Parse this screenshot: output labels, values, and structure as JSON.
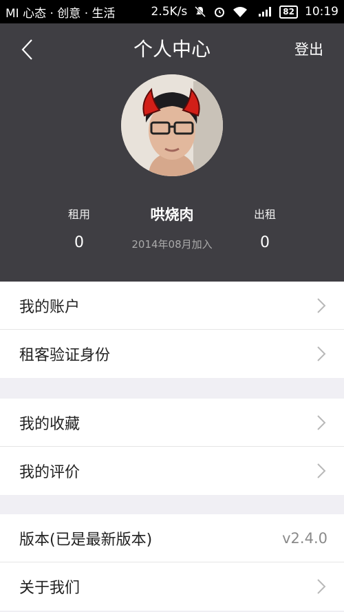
{
  "status_bar": {
    "carrier": "MI 心态 · 创意 · 生活",
    "speed": "2.5K/s",
    "battery": "82",
    "time": "10:19"
  },
  "header": {
    "title": "个人中心",
    "logout_label": "登出",
    "user_name": "哄烧肉",
    "joined": "2014年08月加入",
    "stats": {
      "rent_label": "租用",
      "rent_value": "0",
      "lease_label": "出租",
      "lease_value": "0"
    }
  },
  "menu": {
    "group1": [
      {
        "label": "我的账户"
      },
      {
        "label": "租客验证身份"
      }
    ],
    "group2": [
      {
        "label": "我的收藏"
      },
      {
        "label": "我的评价"
      }
    ],
    "group3": [
      {
        "label": "版本(已是最新版本)",
        "value": "v2.4.0"
      },
      {
        "label": "关于我们"
      }
    ]
  }
}
